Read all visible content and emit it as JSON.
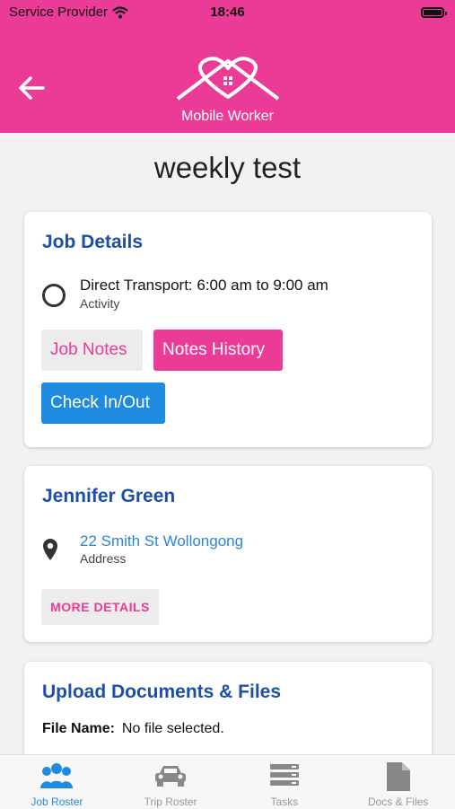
{
  "status_bar": {
    "carrier": "Service Provider",
    "time": "18:46"
  },
  "header": {
    "brand": "Mobile Worker"
  },
  "page": {
    "title": "weekly test"
  },
  "job_details": {
    "title": "Job Details",
    "activity_main": "Direct Transport: 6:00 am to 9:00 am",
    "activity_sub": "Activity",
    "job_notes_label": "Job Notes",
    "notes_history_label": "Notes History",
    "check_label": "Check In/Out"
  },
  "client": {
    "name": "Jennifer Green",
    "address": "22 Smith St Wollongong",
    "address_label": "Address",
    "more_label": "MORE DETAILS"
  },
  "upload": {
    "title": "Upload Documents & Files",
    "file_name_label": "File Name:",
    "file_name_value": "No file selected."
  },
  "tabs": [
    {
      "label": "Job Roster",
      "icon": "people-icon",
      "active": true
    },
    {
      "label": "Trip Roster",
      "icon": "car-icon",
      "active": false
    },
    {
      "label": "Tasks",
      "icon": "list-icon",
      "active": false
    },
    {
      "label": "Docs & Files",
      "icon": "document-icon",
      "active": false
    }
  ],
  "colors": {
    "brand_pink": "#ec3b97",
    "title_blue": "#1c4fa8",
    "action_blue": "#1f8be0"
  }
}
